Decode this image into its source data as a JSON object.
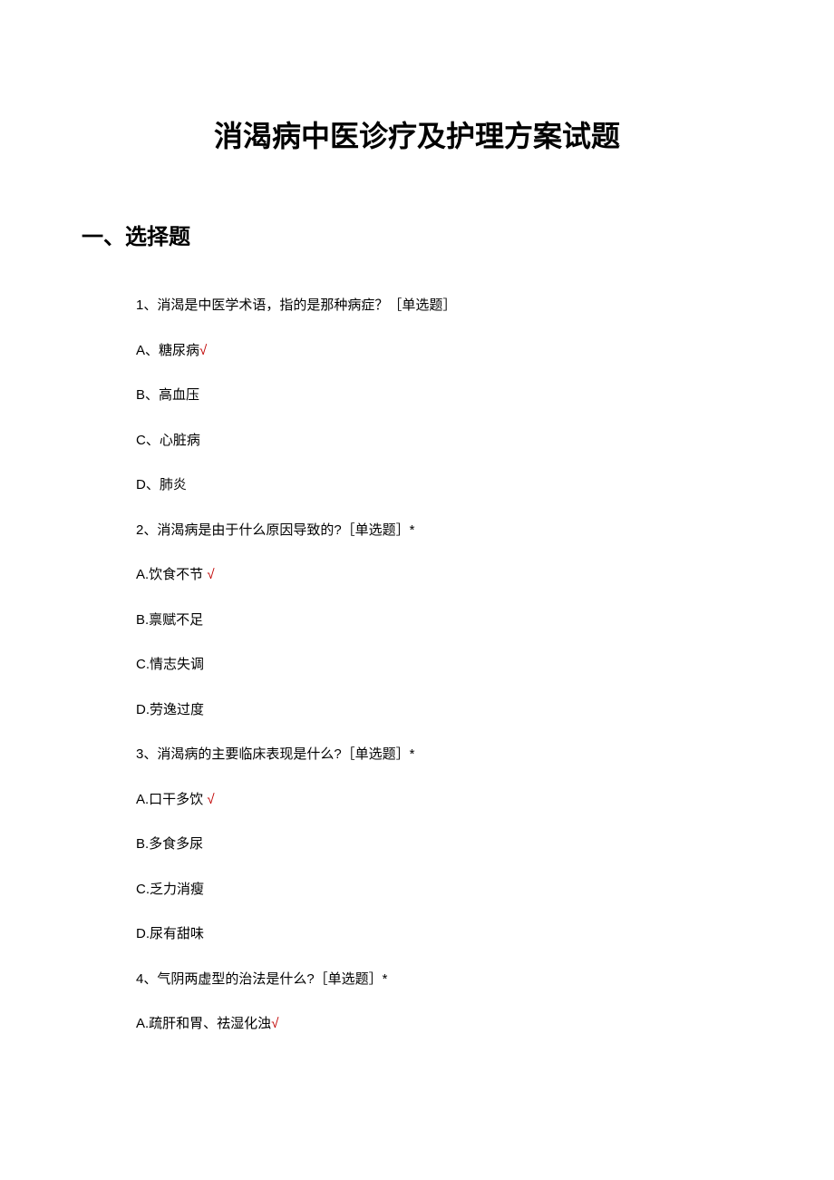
{
  "title": "消渴病中医诊疗及护理方案试题",
  "section_heading": "一、选择题",
  "questions": [
    {
      "stem": "1、消渴是中医学术语，指的是那种病症？［单选题］",
      "options": [
        {
          "label": "A、糖尿病",
          "mark": "√"
        },
        {
          "label": "B、高血压",
          "mark": ""
        },
        {
          "label": "C、心脏病",
          "mark": ""
        },
        {
          "label": "D、肺炎",
          "mark": ""
        }
      ]
    },
    {
      "stem": "2、消渴病是由于什么原因导致的?［单选题］*",
      "options": [
        {
          "label": "A.饮食不节",
          "mark": "√"
        },
        {
          "label": "B.禀赋不足",
          "mark": ""
        },
        {
          "label": "C.情志失调",
          "mark": ""
        },
        {
          "label": "D.劳逸过度",
          "mark": ""
        }
      ]
    },
    {
      "stem": "3、消渴病的主要临床表现是什么?［单选题］*",
      "options": [
        {
          "label": "A.口干多饮",
          "mark": "√"
        },
        {
          "label": "B.多食多尿",
          "mark": ""
        },
        {
          "label": "C.乏力消瘦",
          "mark": ""
        },
        {
          "label": "D.尿有甜味",
          "mark": ""
        }
      ]
    },
    {
      "stem": "4、气阴两虚型的治法是什么?［单选题］*",
      "options": [
        {
          "label": "A.疏肝和胃、祛湿化浊",
          "mark": "√"
        }
      ]
    }
  ]
}
